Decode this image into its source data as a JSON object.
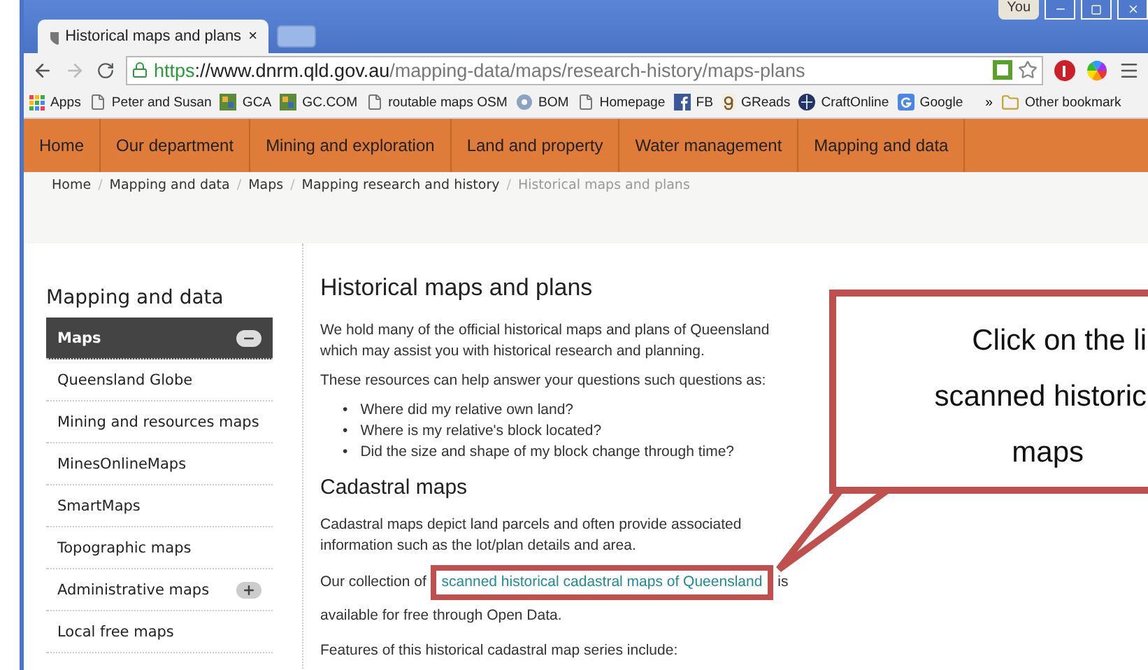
{
  "browser": {
    "tab": {
      "title": "Historical maps and plans",
      "close": "×"
    },
    "user": "You",
    "url": {
      "scheme": "https",
      "host": "://www.dnrm.qld.gov.au",
      "path": "/mapping-data/maps/research-history/maps-plans"
    },
    "bookmarks": [
      {
        "label": "Apps",
        "kind": "apps"
      },
      {
        "label": "Peter and Susan",
        "kind": "page"
      },
      {
        "label": "GCA",
        "kind": "tile"
      },
      {
        "label": "GC.COM",
        "kind": "tile"
      },
      {
        "label": "routable maps OSM",
        "kind": "page"
      },
      {
        "label": "BOM",
        "kind": "disc"
      },
      {
        "label": "Homepage",
        "kind": "page"
      },
      {
        "label": "FB",
        "kind": "fb"
      },
      {
        "label": "GReads",
        "kind": "g"
      },
      {
        "label": "CraftOnline",
        "kind": "globe"
      },
      {
        "label": "Google",
        "kind": "google"
      }
    ],
    "overflow": "»",
    "other": "Other bookmark"
  },
  "nav": [
    {
      "label": "Home"
    },
    {
      "label": "Our department"
    },
    {
      "label": "Mining and exploration"
    },
    {
      "label": "Land and property"
    },
    {
      "label": "Water management"
    },
    {
      "label": "Mapping and data"
    }
  ],
  "breadcrumb": [
    {
      "label": "Home",
      "current": false
    },
    {
      "label": "Mapping and data",
      "current": false
    },
    {
      "label": "Maps",
      "current": false
    },
    {
      "label": "Mapping research and history",
      "current": false
    },
    {
      "label": "Historical maps and plans",
      "current": true
    }
  ],
  "breadcrumb_separator": "/",
  "sidebar": {
    "title": "Mapping and data",
    "items": [
      {
        "label": "Maps",
        "selected": true,
        "kind": "collapsible"
      },
      {
        "label": "Queensland Globe",
        "selected": false,
        "kind": "plain"
      },
      {
        "label": "Mining and resources maps",
        "selected": false,
        "kind": "plain"
      },
      {
        "label": "MinesOnlineMaps",
        "selected": false,
        "kind": "plain"
      },
      {
        "label": "SmartMaps",
        "selected": false,
        "kind": "plain"
      },
      {
        "label": "Topographic maps",
        "selected": false,
        "kind": "plain"
      },
      {
        "label": "Administrative maps",
        "selected": false,
        "kind": "expandable"
      },
      {
        "label": "Local free maps",
        "selected": false,
        "kind": "plain"
      }
    ]
  },
  "main": {
    "title": "Historical maps and plans",
    "intro": "We hold many of the official historical maps and plans of Queensland which may assist you with historical research and planning.",
    "lead": "These resources can help answer your questions such questions as:",
    "bullet_mark": "•",
    "bullets": [
      "Where did my relative own land?",
      "Where is my relative's block located?",
      "Did the size and shape of my block change through time?"
    ],
    "section": "Cadastral maps",
    "section_text": "Cadastral maps depict land parcels and often provide associated information such as the lot/plan details and area.",
    "link_before": "Our collection of ",
    "link": "scanned historical cadastral maps of Queensland",
    "link_after": " is available for free through Open Data.",
    "features": "Features of this historical cadastral map series include:"
  },
  "callout": {
    "lines": [
      "Click on the li",
      "scanned historic",
      "maps"
    ]
  }
}
